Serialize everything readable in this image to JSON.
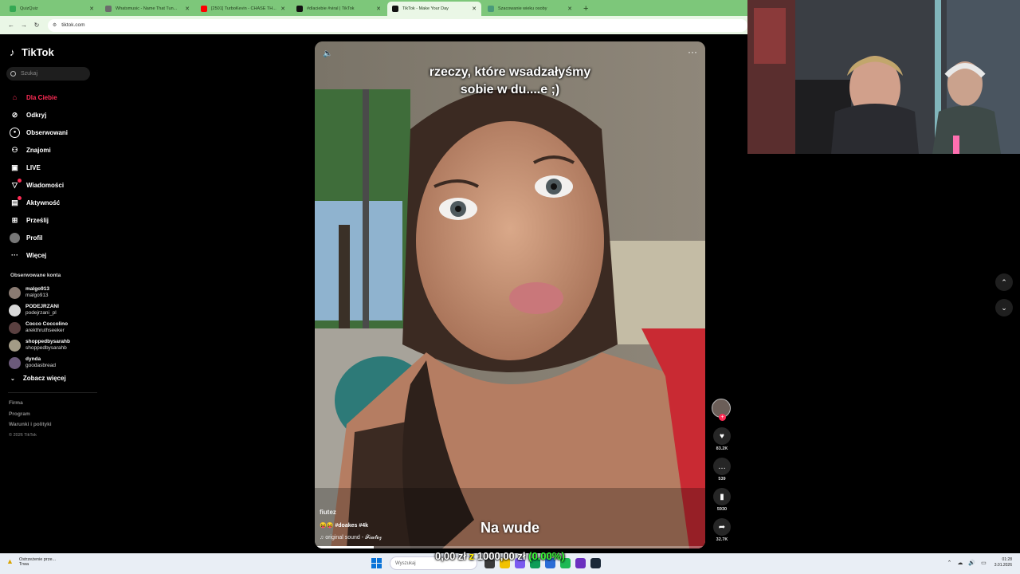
{
  "browser": {
    "tabs": [
      {
        "label": "QuizQuiz",
        "color": "#34a853",
        "active": false
      },
      {
        "label": "Whatsmusic - Name That Tun...",
        "color": "#6b6b6b",
        "active": false
      },
      {
        "label": "[2501] TurboKevin - CHASE TH...",
        "color": "#ff0000",
        "active": false
      },
      {
        "label": "#dlaciebie #viral | TikTok",
        "color": "#111111",
        "active": false
      },
      {
        "label": "TikTok - Make Your Day",
        "color": "#111111",
        "active": true
      },
      {
        "label": "Szacowanie wieku osoby",
        "color": "#4a9a7a",
        "active": false
      }
    ],
    "url": "tiktok.com"
  },
  "sidebar": {
    "logo": "TikTok",
    "search_placeholder": "Szukaj",
    "nav": [
      {
        "label": "Dla Ciebie",
        "icon": "home-icon",
        "glyph": "⌂",
        "active": true
      },
      {
        "label": "Odkryj",
        "icon": "compass-icon",
        "glyph": "⊘",
        "active": false
      },
      {
        "label": "Obserwowani",
        "icon": "following-icon",
        "glyph": "●",
        "active": false
      },
      {
        "label": "Znajomi",
        "icon": "friends-icon",
        "glyph": "⚇",
        "active": false
      },
      {
        "label": "LIVE",
        "icon": "live-icon",
        "glyph": "▣",
        "active": false
      },
      {
        "label": "Wiadomości",
        "icon": "messages-icon",
        "glyph": "▽",
        "active": false,
        "badge": true
      },
      {
        "label": "Aktywność",
        "icon": "activity-icon",
        "glyph": "▤",
        "active": false,
        "badge": true
      },
      {
        "label": "Prześlij",
        "icon": "upload-icon",
        "glyph": "⊞",
        "active": false
      },
      {
        "label": "Profil",
        "icon": "profile-icon",
        "glyph": "",
        "active": false
      },
      {
        "label": "Więcej",
        "icon": "more-icon",
        "glyph": "···",
        "active": false
      }
    ],
    "following_title": "Obserwowane konta",
    "following": [
      {
        "name": "malgo913",
        "user": "malgo913",
        "color": "#8a7b72"
      },
      {
        "name": "PODEJRZANI",
        "user": "podejrzani_pl",
        "color": "#d8d8d8"
      },
      {
        "name": "Cocco Coccolino",
        "user": "arekthruthseeker",
        "color": "#5a4040"
      },
      {
        "name": "shoppedbysarahb",
        "user": "shoppedbysarahb",
        "color": "#a39b86"
      },
      {
        "name": "dynda",
        "user": "goodasbread",
        "color": "#6b5a7a"
      }
    ],
    "see_more": "Zobacz więcej",
    "footer": [
      "Firma",
      "Program",
      "Warunki i polityki"
    ],
    "copyright": "© 2026 TikTok"
  },
  "video": {
    "caption_line1": "rzeczy, które wsadzałyśmy",
    "caption_line2": "sobie w du....e ;)",
    "subtitle": "Na wude",
    "author": "fiutez",
    "tags": "😝😝 #doakes #4k",
    "sound": "♫  original sound - 𝓕𝓲𝓾𝓽𝓮𝔃",
    "progress": 0.15
  },
  "actions": {
    "likes": "83.2K",
    "comments": "539",
    "saves": "5930",
    "shares": "32.7K"
  },
  "overlay": {
    "amount": "0,00 zł",
    "separator": "z",
    "goal": "1000,00 zł",
    "percent": "(0.00%)"
  },
  "taskbar": {
    "notif_title": "Ostrzeżenie prze...",
    "notif_sub": "Trwa",
    "search_placeholder": "Wyszukaj",
    "time": "01:28",
    "date": "3.01.2026"
  }
}
